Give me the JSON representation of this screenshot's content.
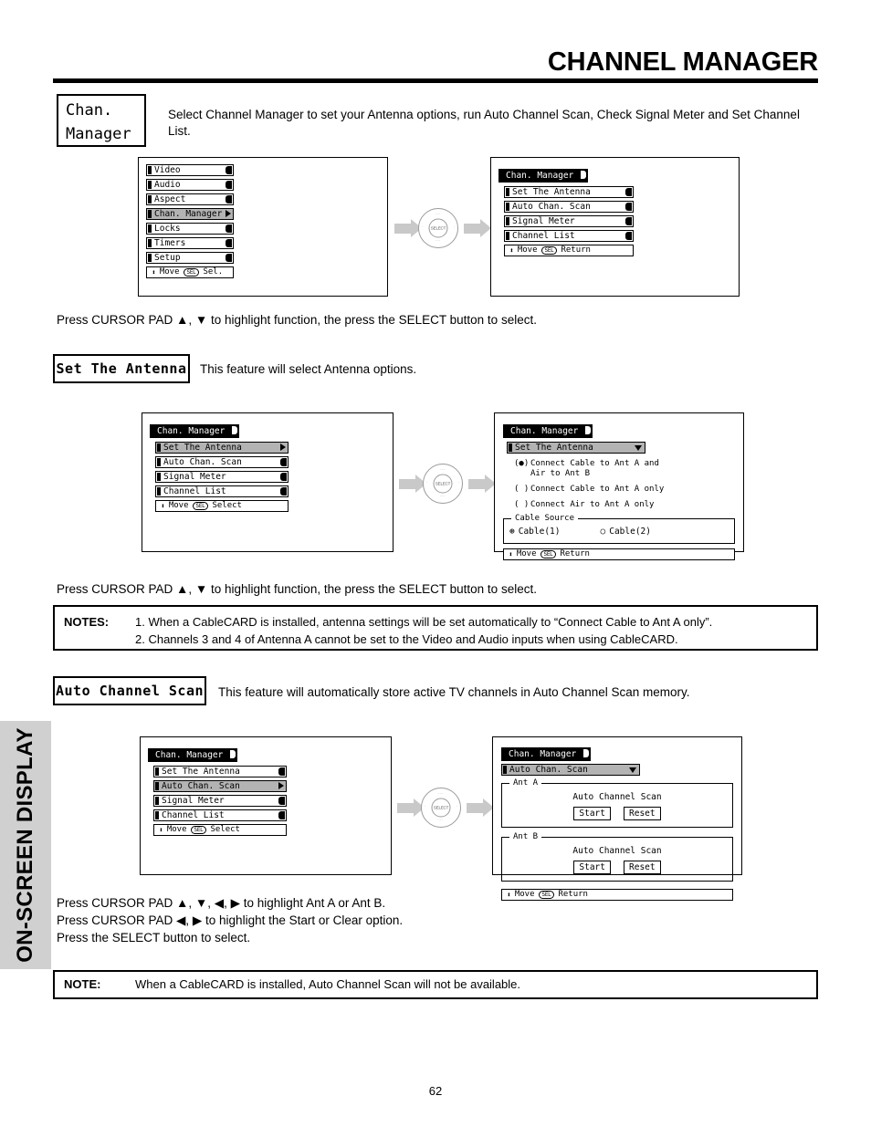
{
  "header": {
    "title": "CHANNEL MANAGER",
    "side_tab": "ON-SCREEN DISPLAY",
    "page_number": "62"
  },
  "intro": {
    "badge_line1": "Chan.",
    "badge_line2": "Manager",
    "description": "Select Channel Manager to set your Antenna options, run Auto Channel Scan, Check Signal Meter and Set Channel List."
  },
  "icons": {
    "dpad_center": "SELECT",
    "sel_badge": "SEL",
    "updown_arrow": "⬍",
    "right_arrow": "▶",
    "down_arrow": "▼",
    "radio_selected": "(●)",
    "radio_empty": "( )",
    "bullet_selected": "⊛",
    "bullet_empty": "○"
  },
  "diagram1": {
    "left_menu": {
      "items": [
        {
          "label": "Video",
          "selected": false
        },
        {
          "label": "Audio",
          "selected": false
        },
        {
          "label": "Aspect",
          "selected": false
        },
        {
          "label": "Chan. Manager",
          "selected": true
        },
        {
          "label": "Locks",
          "selected": false
        },
        {
          "label": "Timers",
          "selected": false
        },
        {
          "label": "Setup",
          "selected": false
        }
      ],
      "footer_move": "Move",
      "footer_action": "Sel."
    },
    "right_menu": {
      "title": "Chan. Manager",
      "items": [
        {
          "label": "Set The Antenna",
          "selected": false
        },
        {
          "label": "Auto Chan. Scan",
          "selected": false
        },
        {
          "label": "Signal Meter",
          "selected": false
        },
        {
          "label": "Channel List",
          "selected": false
        }
      ],
      "footer_move": "Move",
      "footer_action": "Return"
    }
  },
  "instruction1": "Press CURSOR PAD ▲, ▼ to highlight function, the press the SELECT button to select.",
  "section_antenna": {
    "badge": "Set The Antenna",
    "caption": "This feature will select Antenna options.",
    "left_menu": {
      "title": "Chan. Manager",
      "items": [
        {
          "label": "Set The Antenna",
          "selected": true
        },
        {
          "label": "Auto Chan. Scan",
          "selected": false
        },
        {
          "label": "Signal Meter",
          "selected": false
        },
        {
          "label": "Channel List",
          "selected": false
        }
      ],
      "footer_move": "Move",
      "footer_action": "Select"
    },
    "right_menu": {
      "title": "Chan. Manager",
      "subtitle": "Set The Antenna",
      "options": [
        {
          "mark": "(●)",
          "label": "Connect Cable to Ant A and\nAir to Ant B"
        },
        {
          "mark": "( )",
          "label": "Connect Cable to Ant A only"
        },
        {
          "mark": "( )",
          "label": "Connect Air to Ant A only"
        }
      ],
      "cable_group_legend": "Cable Source",
      "cable_options": [
        {
          "mark": "⊛",
          "label": "Cable(1)"
        },
        {
          "mark": "○",
          "label": "Cable(2)"
        }
      ],
      "footer_move": "Move",
      "footer_action": "Return"
    },
    "instruction": "Press CURSOR PAD ▲, ▼ to highlight function, the press the SELECT button to select."
  },
  "notes_antenna": {
    "label": "NOTES:",
    "items": [
      "1. When a CableCARD is installed, antenna settings will be set automatically to “Connect Cable to Ant A only”.",
      "2. Channels 3 and 4 of Antenna A cannot be set to the Video and Audio inputs when using CableCARD."
    ]
  },
  "section_scan": {
    "badge": "Auto Channel Scan",
    "caption": "This feature will automatically store active TV channels in Auto Channel Scan memory.",
    "left_menu": {
      "title": "Chan. Manager",
      "items": [
        {
          "label": "Set The Antenna",
          "selected": false
        },
        {
          "label": "Auto Chan. Scan",
          "selected": true
        },
        {
          "label": "Signal Meter",
          "selected": false
        },
        {
          "label": "Channel List",
          "selected": false
        }
      ],
      "footer_move": "Move",
      "footer_action": "Select"
    },
    "right_menu": {
      "title": "Chan. Manager",
      "subtitle": "Auto Chan. Scan",
      "groups": [
        {
          "legend": "Ant A",
          "scan_label": "Auto Channel Scan",
          "buttons": [
            "Start",
            "Reset"
          ]
        },
        {
          "legend": "Ant B",
          "scan_label": "Auto Channel Scan",
          "buttons": [
            "Start",
            "Reset"
          ]
        }
      ],
      "footer_move": "Move",
      "footer_action": "Return"
    },
    "instructions": [
      "Press CURSOR PAD ▲, ▼, ◀, ▶ to highlight Ant A or Ant B.",
      "Press CURSOR PAD ◀, ▶ to highlight the Start or Clear option.",
      "Press the SELECT button to select."
    ]
  },
  "note_scan": {
    "label": "NOTE:",
    "text": "When a CableCARD is installed, Auto Channel Scan will not be available."
  }
}
